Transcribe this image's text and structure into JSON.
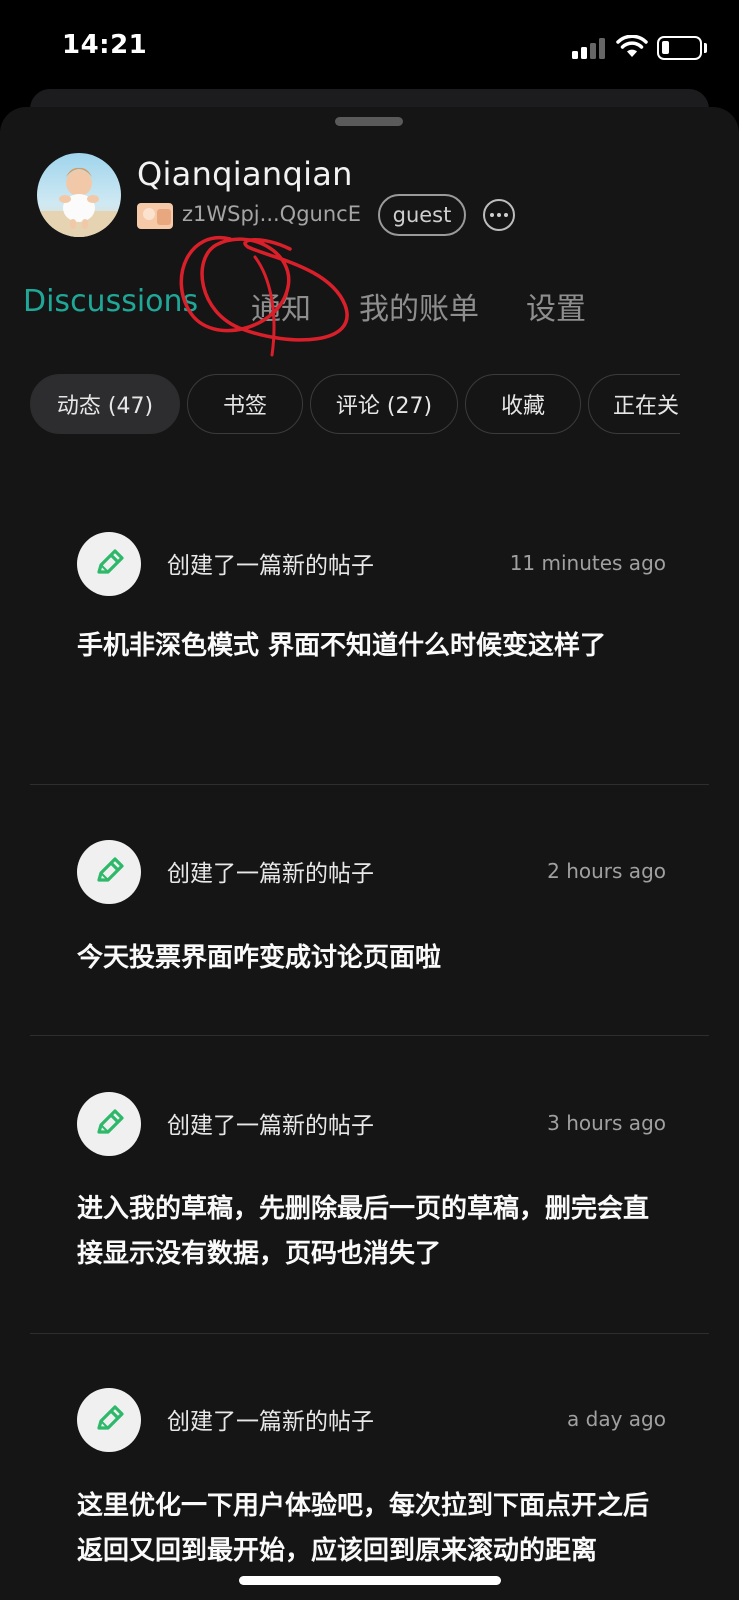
{
  "status_bar": {
    "time": "14:21",
    "signal_icon": "cellular-signal-icon",
    "wifi_icon": "wifi-icon",
    "battery_icon": "battery-icon",
    "battery_level": 0.2
  },
  "profile": {
    "username": "Qianqianqian",
    "wallet_address": "z1WSpj...QguncE",
    "role_badge": "guest",
    "more_icon": "more-horizontal-icon"
  },
  "main_tabs": [
    {
      "label": "Discussions",
      "active": true
    },
    {
      "label": "通知",
      "active": false
    },
    {
      "label": "我的账单",
      "active": false
    },
    {
      "label": "设置",
      "active": false
    }
  ],
  "filter_chips": [
    {
      "label": "动态 (47)",
      "active": true
    },
    {
      "label": "书签",
      "active": false
    },
    {
      "label": "评论 (27)",
      "active": false
    },
    {
      "label": "收藏",
      "active": false
    },
    {
      "label": "正在关",
      "active": false
    }
  ],
  "feed": [
    {
      "icon": "edit-pen-icon",
      "action": "创建了一篇新的帖子",
      "time": "11 minutes ago",
      "text": "手机非深色模式 界面不知道什么时候变这样了"
    },
    {
      "icon": "edit-pen-icon",
      "action": "创建了一篇新的帖子",
      "time": "2 hours ago",
      "text": "今天投票界面咋变成讨论页面啦"
    },
    {
      "icon": "edit-pen-icon",
      "action": "创建了一篇新的帖子",
      "time": "3 hours ago",
      "text": "进入我的草稿，先删除最后一页的草稿，删完会直接显示没有数据，页码也消失了"
    },
    {
      "icon": "edit-pen-icon",
      "action": "创建了一篇新的帖子",
      "time": "a day ago",
      "text": "这里优化一下用户体验吧，每次拉到下面点开之后返回又回到最开始，应该回到原来滚动的距离"
    }
  ],
  "colors": {
    "accent": "#1fa898",
    "icon_green": "#2db86a",
    "background": "#151515",
    "annotation_red": "#d9202a"
  }
}
